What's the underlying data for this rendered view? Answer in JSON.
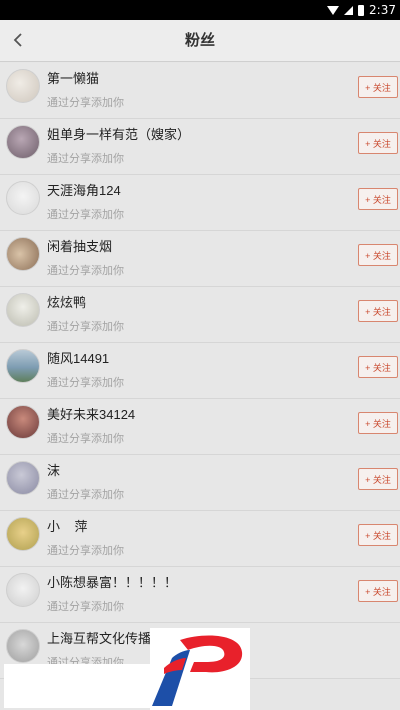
{
  "status_bar": {
    "time": "2:37"
  },
  "header": {
    "title": "粉丝"
  },
  "follow_label": "+ 关注",
  "followers": [
    {
      "name": "第一懒猫",
      "subtitle": "通过分享添加你"
    },
    {
      "name": "姐单身一样有范（嫂家）",
      "subtitle": "通过分享添加你"
    },
    {
      "name": "天涯海角124",
      "subtitle": "通过分享添加你"
    },
    {
      "name": "闲着抽支烟",
      "subtitle": "通过分享添加你"
    },
    {
      "name": "炫炫鸭",
      "subtitle": "通过分享添加你"
    },
    {
      "name": "随风14491",
      "subtitle": "通过分享添加你"
    },
    {
      "name": "美好未来34124",
      "subtitle": "通过分享添加你"
    },
    {
      "name": "沫",
      "subtitle": "通过分享添加你"
    },
    {
      "name": "小    萍",
      "subtitle": "通过分享添加你"
    },
    {
      "name": "小陈想暴富！！！！！",
      "subtitle": "通过分享添加你"
    },
    {
      "name": "上海互帮文化传播有",
      "subtitle": "通过分享添加你"
    }
  ],
  "colors": {
    "accent": "#c94a2f",
    "logo_red": "#e8212b",
    "logo_blue": "#1d4fa8"
  }
}
